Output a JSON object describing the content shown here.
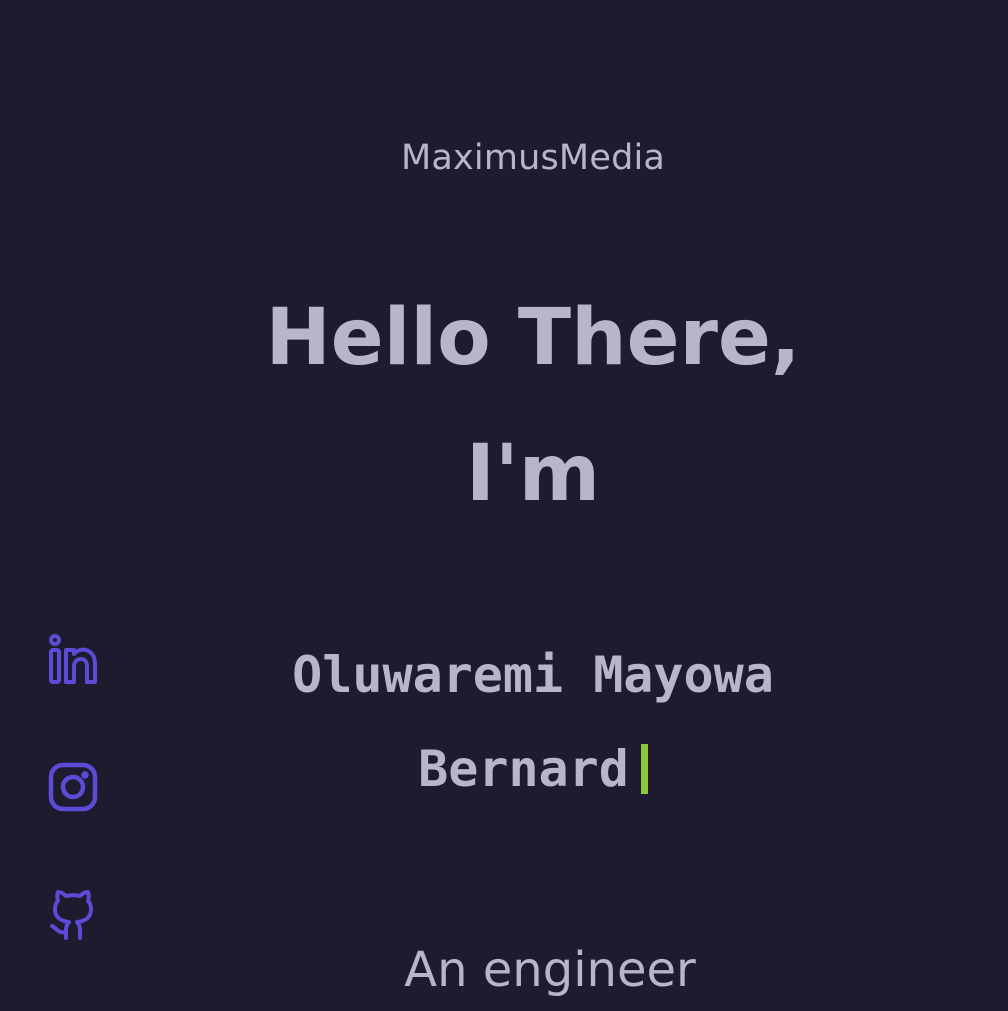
{
  "header": {
    "brand": "MaximusMedia"
  },
  "hero": {
    "greeting_line1": "Hello There,",
    "greeting_line2": "I'm"
  },
  "typed_name": {
    "line1": "Oluwaremi Mayowa",
    "line2": "Bernard"
  },
  "subtitle": "An engineer",
  "social_links": [
    {
      "icon": "linkedin-icon"
    },
    {
      "icon": "instagram-icon"
    },
    {
      "icon": "github-icon"
    }
  ],
  "colors": {
    "background": "#1e1b2f",
    "text": "#b9b5c9",
    "accent": "#5b4bd6",
    "cursor": "#8dc63f"
  }
}
